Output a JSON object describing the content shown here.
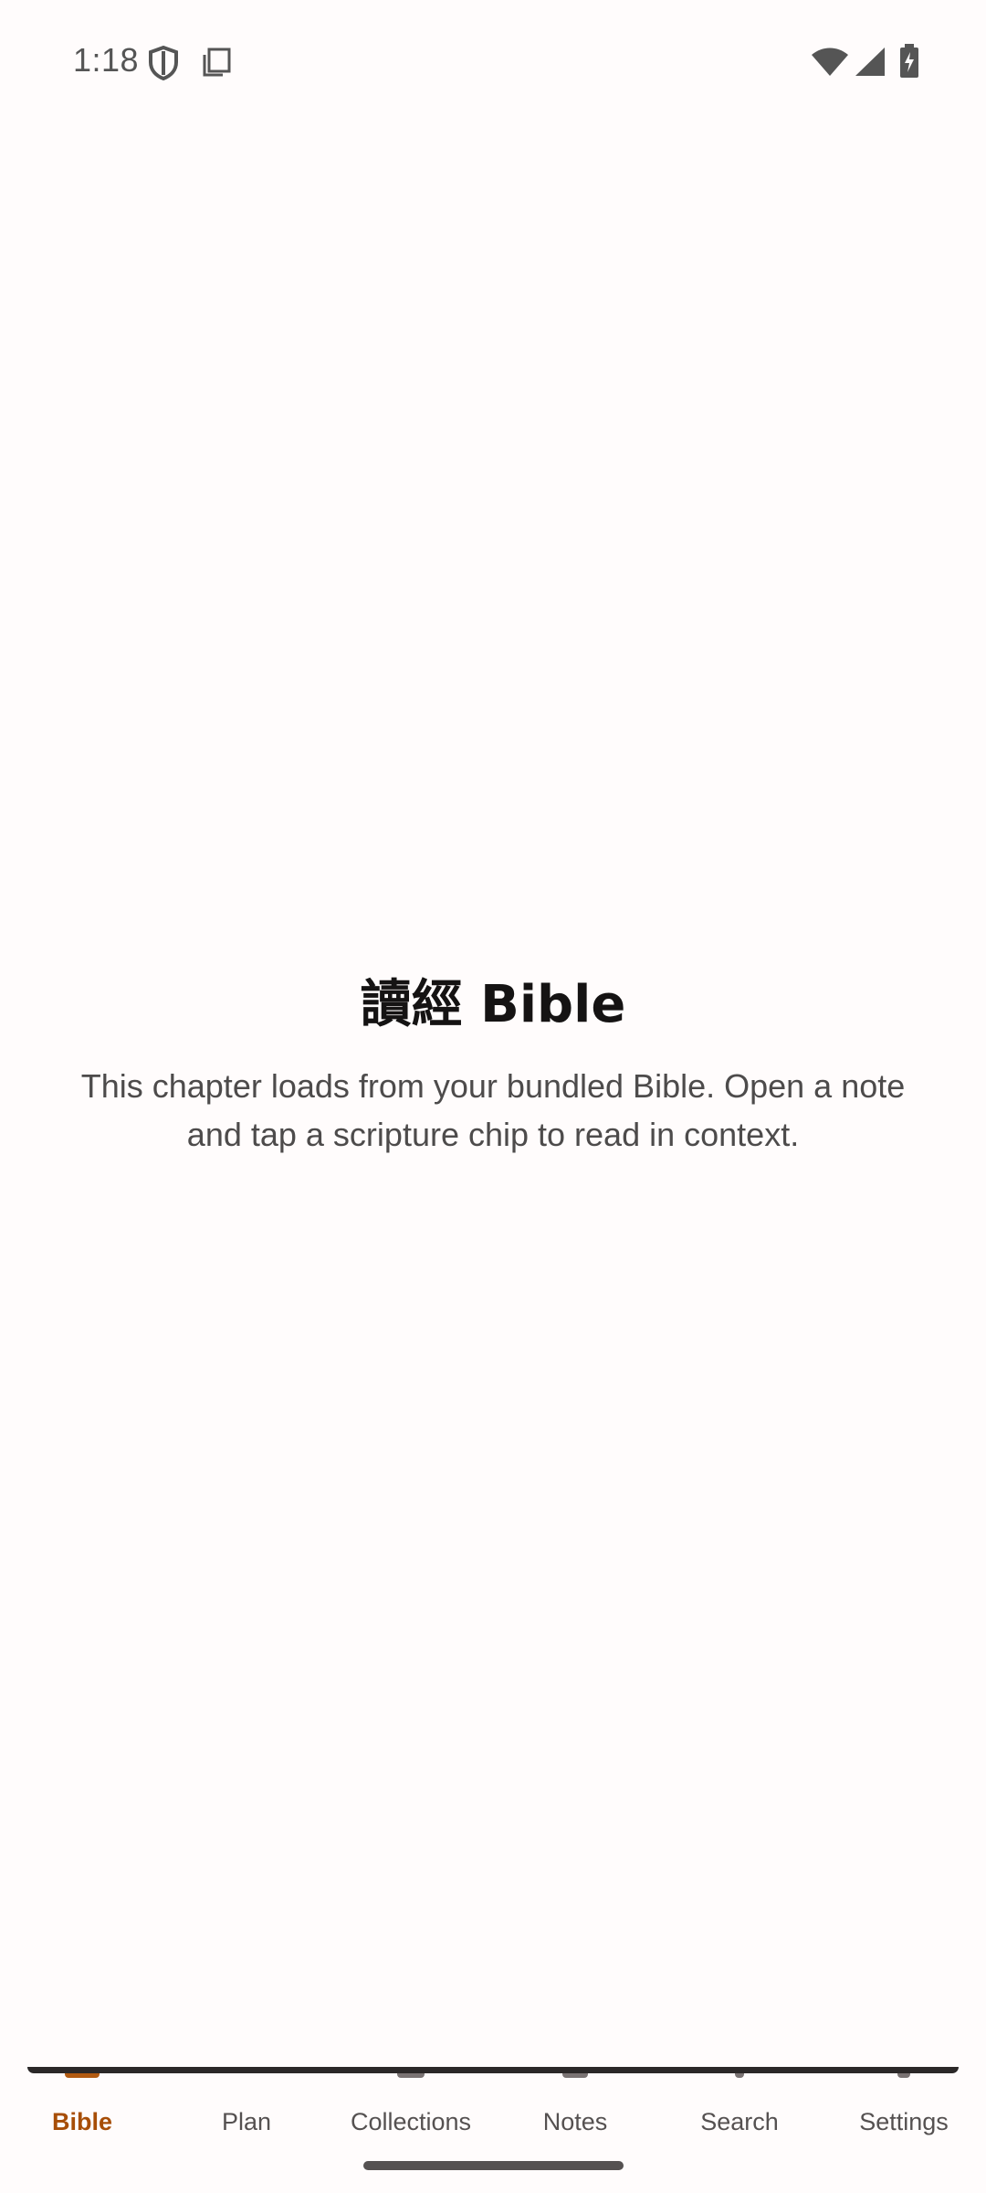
{
  "status_bar": {
    "time": "1:18",
    "icons": [
      "shield-icon",
      "screenshot-icon",
      "wifi-icon",
      "signal-icon",
      "battery-charging-icon"
    ]
  },
  "empty_state": {
    "title": "讀經 Bible",
    "description": "This chapter loads from your bundled Bible. Open a note and tap a scripture chip to read in context."
  },
  "bottom_nav": {
    "active_index": 0,
    "active_color": "#a74e07",
    "items": [
      {
        "label": "Bible",
        "icon": "book-icon"
      },
      {
        "label": "Plan",
        "icon": "calendar-icon"
      },
      {
        "label": "Collections",
        "icon": "collections-icon"
      },
      {
        "label": "Notes",
        "icon": "notes-icon"
      },
      {
        "label": "Search",
        "icon": "search-icon"
      },
      {
        "label": "Settings",
        "icon": "gear-icon"
      }
    ]
  }
}
